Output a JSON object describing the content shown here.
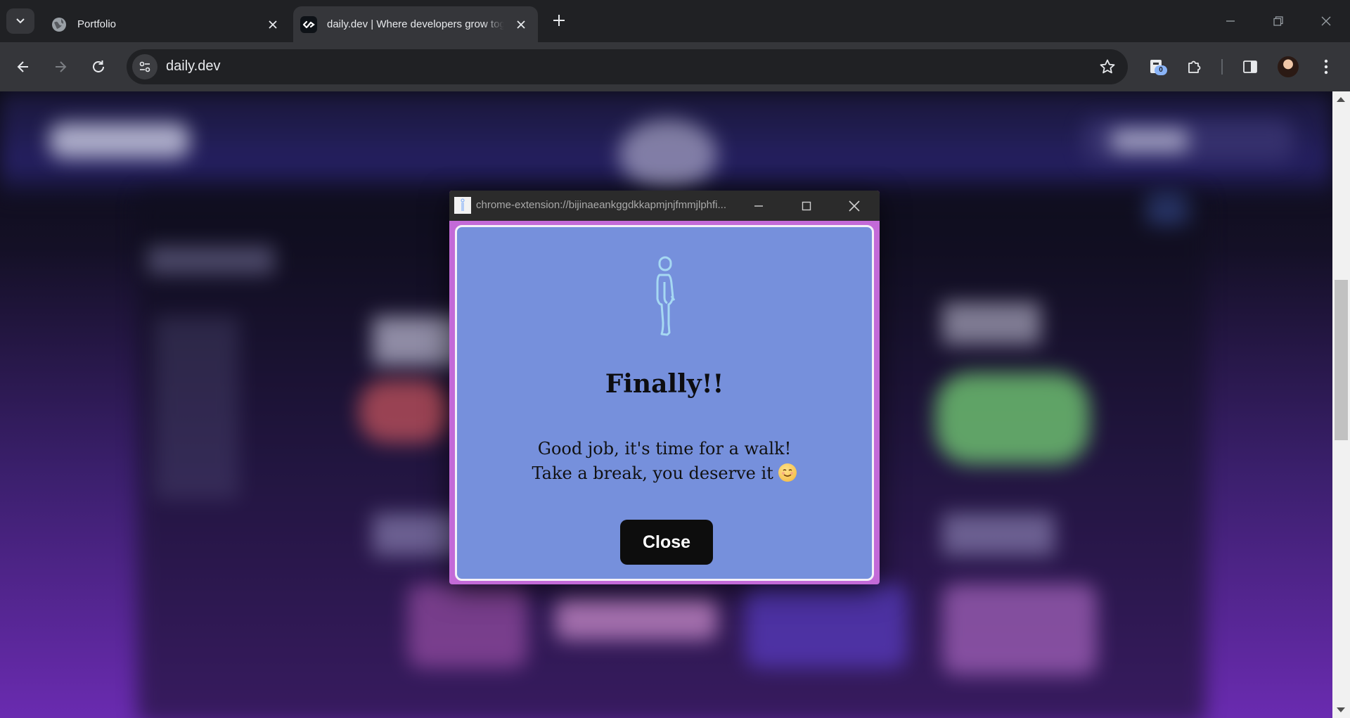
{
  "browser": {
    "tabs": [
      {
        "title": "Portfolio",
        "favicon": "globe-icon",
        "active": false
      },
      {
        "title": "daily.dev | Where developers grow together",
        "favicon": "dailydev-logo-icon",
        "active": true
      }
    ],
    "address_bar": {
      "url": "daily.dev"
    },
    "extensions_badge": "0",
    "colors": {
      "tabstrip": "#202124",
      "toolbar": "#35363a",
      "omnibox": "#202124"
    }
  },
  "popup": {
    "window_url": "chrome-extension://bijinaeankggdkkapmjnjfmmjlphfi...",
    "headline": "Finally!!",
    "message_line1": "Good job, it's time for a walk!",
    "message_line2": "Take a break, you deserve it",
    "close_label": "Close",
    "colors": {
      "frame": "#c36ad8",
      "body": "#7690dc",
      "button": "#0d0d0d"
    }
  }
}
